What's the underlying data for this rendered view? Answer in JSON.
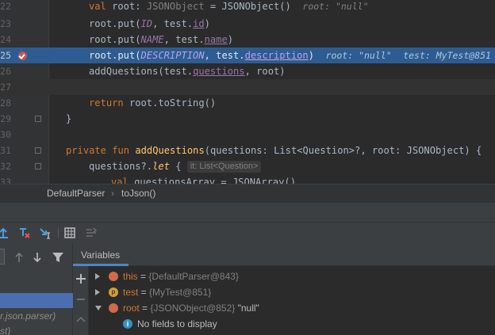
{
  "editor": {
    "line_numbers": [
      "22",
      "23",
      "24",
      "25",
      "26",
      "27",
      "28",
      "29",
      "30",
      "31",
      "32",
      "33"
    ],
    "lines": {
      "l22": {
        "kw": "val",
        "name": " root: ",
        "type_hint": "JSONObject",
        "rest": " = JSONObject()",
        "inline": "root: \"null\""
      },
      "l23": {
        "pre": "root.put(",
        "const": "ID",
        "mid": ", test.",
        "prop": "id",
        "post": ")"
      },
      "l24": {
        "pre": "root.put(",
        "const": "NAME",
        "mid": ", test.",
        "prop": "name",
        "post": ")"
      },
      "l25": {
        "pre": "root.put(",
        "const": "DESCRIPTION",
        "mid": ", test.",
        "prop": "description",
        "post": ")",
        "inline1": "root: \"null\"",
        "inline2": "test: MyTest@851"
      },
      "l26": {
        "pre": "addQuestions(test.",
        "prop": "questions",
        "post": ", root)"
      },
      "l28": {
        "kw": "return",
        "rest": " root.toString()"
      },
      "l29": {
        "text": "}"
      },
      "l31": {
        "kw1": "private fun ",
        "fn": "addQuestions",
        "rest": "(questions: List<Question>?, root: JSONObject) {"
      },
      "l32": {
        "pre": "questions?.",
        "it": "let",
        "post": " { ",
        "hint": "it: List<Question>"
      },
      "l33": {
        "kw": "val",
        "rest": " questionsArray = JSONArray()"
      }
    }
  },
  "breadcrumb": {
    "class_name": "DefaultParser",
    "method_name": "toJson()"
  },
  "debug": {
    "tabs": {
      "variables": "Variables"
    },
    "frames": {
      "row1": "",
      "row2": "r.json.parser)",
      "row3": "st)"
    },
    "variables": [
      {
        "name": "this",
        "eq": " = ",
        "value": "{DefaultParser@843}"
      },
      {
        "name": "test",
        "eq": " = ",
        "value": "{MyTest@851}"
      },
      {
        "name": "root",
        "eq": " = ",
        "value": "{JSONObject@852}",
        "str": " \"null\""
      },
      {
        "info": "No fields to display"
      }
    ]
  },
  "colors": {
    "editor_bg": "#2b2b2b",
    "execution_line": "#2d5c92",
    "keyword": "#cc7832",
    "constant": "#9876aa",
    "function": "#ffc66d",
    "breakpoint": "#c75450",
    "selected_frame": "#4b6eaf"
  },
  "icons": [
    "breakpoint-icon",
    "fold-marker-icon",
    "step-out-icon",
    "drop-frame-icon",
    "run-to-cursor-icon",
    "evaluate-icon",
    "trace-icon",
    "add-watch-icon",
    "up-arrow-icon",
    "down-arrow-icon",
    "filter-icon"
  ]
}
